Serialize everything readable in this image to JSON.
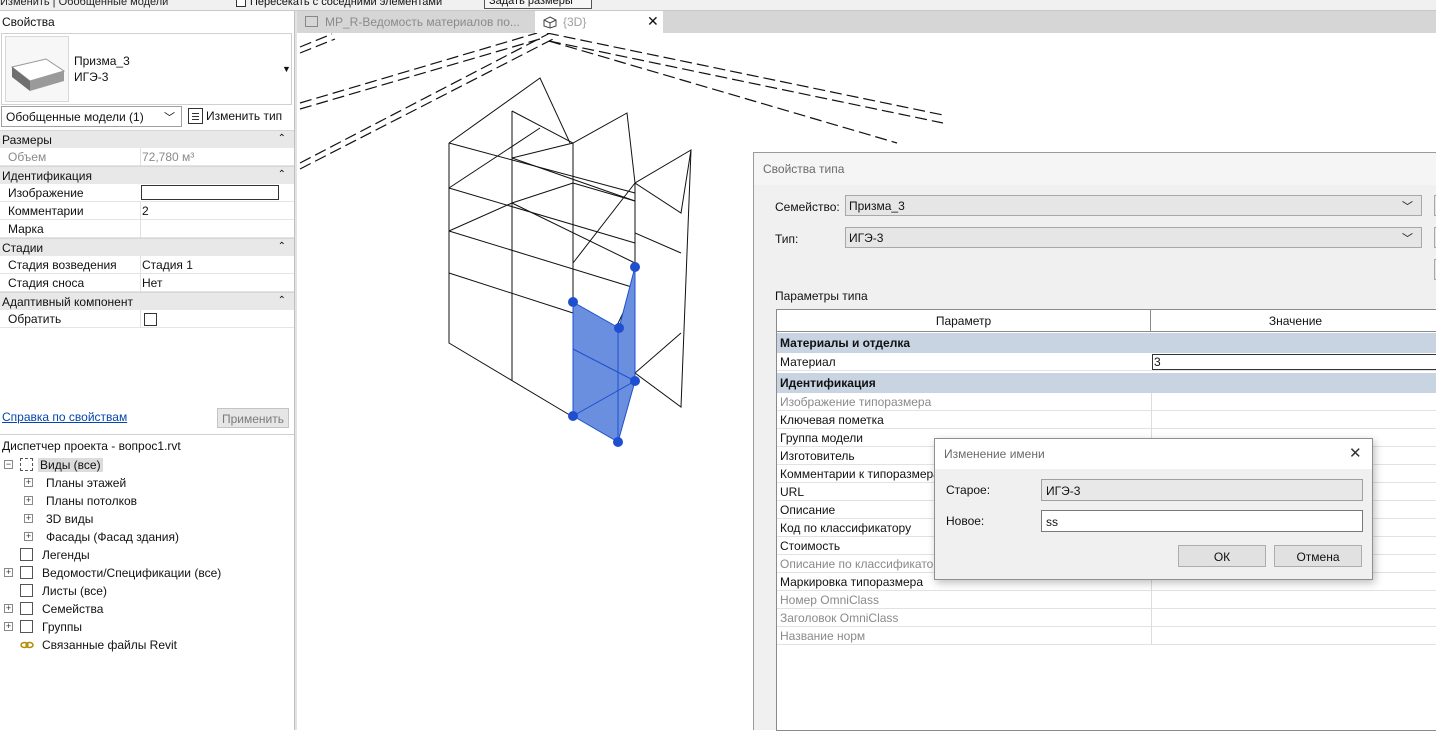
{
  "ribbon": {
    "context_label": "Изменить | Обобщенные модели",
    "checkbox_label": "Пересекать с соседними элементами",
    "button_label": "Задать размеры"
  },
  "properties": {
    "title": "Свойства",
    "type_name": "Призма_3",
    "type_sub": "ИГЭ-3",
    "category_select": "Обобщенные модели (1)",
    "edit_type_label": "Изменить тип",
    "groups": {
      "dimensions": "Размеры",
      "identity": "Идентификация",
      "phases": "Стадии",
      "adaptive": "Адаптивный компонент"
    },
    "rows": {
      "volume_label": "Объем",
      "volume_value": "72,780 м³",
      "image_label": "Изображение",
      "comments_label": "Комментарии",
      "comments_value": "2",
      "mark_label": "Марка",
      "phase_created_label": "Стадия возведения",
      "phase_created_value": "Стадия 1",
      "phase_demolished_label": "Стадия сноса",
      "phase_demolished_value": "Нет",
      "flip_label": "Обратить"
    },
    "help_link": "Справка по свойствам",
    "apply_label": "Применить"
  },
  "browser": {
    "title": "Диспетчер проекта - вопрос1.rvt",
    "items": [
      "Виды (все)",
      "Планы этажей",
      "Планы потолков",
      "3D виды",
      "Фасады (Фасад здания)",
      "Легенды",
      "Ведомости/Спецификации (все)",
      "Листы (все)",
      "Семейства",
      "Группы",
      "Связанные файлы Revit"
    ]
  },
  "tabs": {
    "tab1": "MP_R-Ведомость материалов по...",
    "tab2": "{3D}",
    "close_glyph": "✕"
  },
  "type_dialog": {
    "title": "Свойства типа",
    "family_label": "Семейство:",
    "family_value": "Призма_3",
    "type_label": "Тип:",
    "type_value": "ИГЭ-3",
    "params_label": "Параметры типа",
    "col_param": "Параметр",
    "col_value": "Значение",
    "group_materials": "Материалы и отделка",
    "material_label": "Материал",
    "material_value": "3",
    "group_identity": "Идентификация",
    "rows": [
      {
        "label": "Изображение типоразмера",
        "dim": true
      },
      {
        "label": "Ключевая пометка",
        "dim": false
      },
      {
        "label": "Группа модели",
        "dim": false
      },
      {
        "label": "Изготовитель",
        "dim": false
      },
      {
        "label": "Комментарии к типоразмерам",
        "dim": false
      },
      {
        "label": "URL",
        "dim": false
      },
      {
        "label": "Описание",
        "dim": false
      },
      {
        "label": "Код по классификатору",
        "dim": false
      },
      {
        "label": "Стоимость",
        "dim": false
      },
      {
        "label": "Описание по классификатору",
        "dim": true
      },
      {
        "label": "Маркировка типоразмера",
        "dim": false
      },
      {
        "label": "Номер OmniClass",
        "dim": true
      },
      {
        "label": "Заголовок OmniClass",
        "dim": true
      },
      {
        "label": "Название норм",
        "dim": true
      }
    ]
  },
  "rename_dialog": {
    "title": "Изменение имени",
    "close_glyph": "✕",
    "old_label": "Старое:",
    "old_value": "ИГЭ-3",
    "new_label": "Новое:",
    "new_value": "ss",
    "ok_label": "ОК",
    "cancel_label": "Отмена"
  },
  "colors": {
    "selection_fill": "#6a8fde",
    "grip": "#1f4fd0"
  },
  "icons": [
    "prism-thumbnail-icon",
    "edit-type-icon",
    "collapse-icon",
    "views-icon",
    "legend-icon",
    "schedule-icon",
    "sheets-icon",
    "families-icon",
    "groups-icon",
    "links-icon",
    "schedule-tab-icon",
    "3d-view-icon",
    "close-icon",
    "dropdown-arrow-icon"
  ]
}
